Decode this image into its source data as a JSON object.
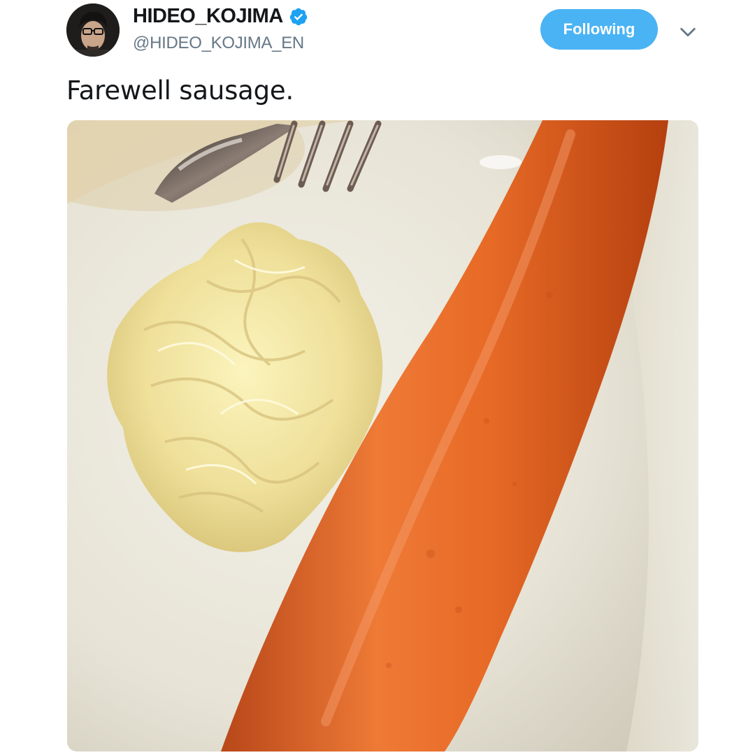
{
  "user": {
    "display_name": "HIDEO_KOJIMA",
    "handle": "@HIDEO_KOJIMA_EN",
    "verified": true,
    "avatar_icon": "user-avatar"
  },
  "actions": {
    "follow_label": "Following",
    "menu_icon": "chevron-down-icon"
  },
  "tweet": {
    "text": "Farewell sausage."
  },
  "media": {
    "type": "photo",
    "subject": "sausage-and-sauerkraut-photo"
  },
  "colors": {
    "accent": "#4ab3f4",
    "verified": "#1da1f2",
    "text_primary": "#14171a",
    "text_secondary": "#657786"
  }
}
